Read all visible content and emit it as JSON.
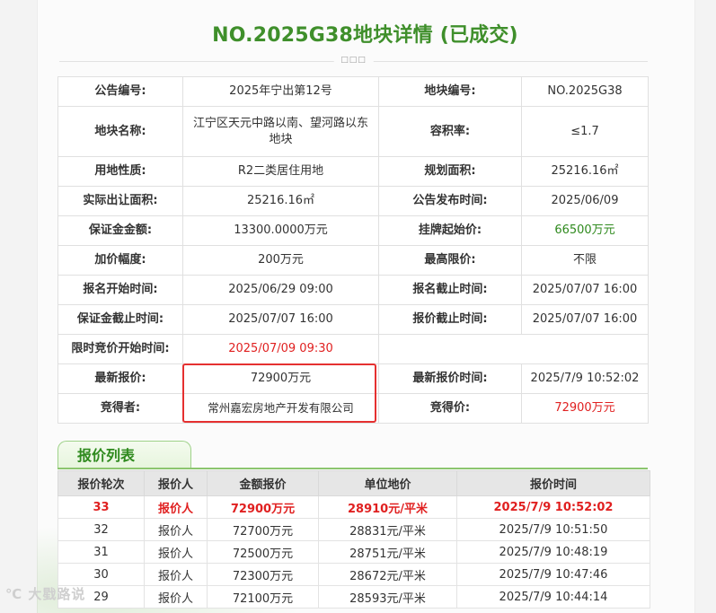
{
  "page": {
    "title": "NO.2025G38地块详情 (已成交)",
    "divider_glyph": "□□□",
    "watermark": "大戥路说",
    "watermark_prefix": "℃"
  },
  "details": {
    "notice_no_label": "公告编号:",
    "notice_no": "2025年宁出第12号",
    "parcel_no_label": "地块编号:",
    "parcel_no": "NO.2025G38",
    "parcel_name_label": "地块名称:",
    "parcel_name": "江宁区天元中路以南、望河路以东地块",
    "far_label": "容积率:",
    "far": "≤1.7",
    "land_use_label": "用地性质:",
    "land_use": "R2二类居住用地",
    "planned_area_label": "规划面积:",
    "planned_area": "25216.16㎡",
    "actual_area_label": "实际出让面积:",
    "actual_area": "25216.16㎡",
    "publish_time_label": "公告发布时间:",
    "publish_time": "2025/06/09",
    "deposit_label": "保证金金额:",
    "deposit": "13300.0000万元",
    "start_price_label": "挂牌起始价:",
    "start_price": "66500万元",
    "increment_label": "加价幅度:",
    "increment": "200万元",
    "max_price_label": "最高限价:",
    "max_price": "不限",
    "reg_start_label": "报名开始时间:",
    "reg_start": "2025/06/29 09:00",
    "reg_end_label": "报名截止时间:",
    "reg_end": "2025/07/07 16:00",
    "deposit_end_label": "保证金截止时间:",
    "deposit_end": "2025/07/07 16:00",
    "bid_end_label": "报价截止时间:",
    "bid_end": "2025/07/07 16:00",
    "timed_bid_label": "限时竞价开始时间:",
    "timed_bid": "2025/07/09 09:30",
    "latest_bid_label": "最新报价:",
    "latest_bid": "72900万元",
    "latest_bid_time_label": "最新报价时间:",
    "latest_bid_time": "2025/7/9 10:52:02",
    "winner_label": "竞得者:",
    "winner": "常州嘉宏房地产开发有限公司",
    "win_price_label": "竞得价:",
    "win_price": "72900万元"
  },
  "bid_list": {
    "tab_label": "报价列表",
    "headers": [
      "报价轮次",
      "报价人",
      "金额报价",
      "单位地价",
      "报价时间"
    ],
    "rows": [
      [
        "33",
        "报价人",
        "72900万元",
        "28910元/平米",
        "2025/7/9 10:52:02"
      ],
      [
        "32",
        "报价人",
        "72700万元",
        "28831元/平米",
        "2025/7/9 10:51:50"
      ],
      [
        "31",
        "报价人",
        "72500万元",
        "28751元/平米",
        "2025/7/9 10:48:19"
      ],
      [
        "30",
        "报价人",
        "72300万元",
        "28672元/平米",
        "2025/7/9 10:47:46"
      ],
      [
        "29",
        "报价人",
        "72100万元",
        "28593元/平米",
        "2025/7/9 10:44:14"
      ]
    ]
  },
  "colors": {
    "title_green": "#3f8f2b",
    "price_green": "#2f8a1e",
    "highlight_red": "#e02020",
    "box_red": "#e53030"
  }
}
